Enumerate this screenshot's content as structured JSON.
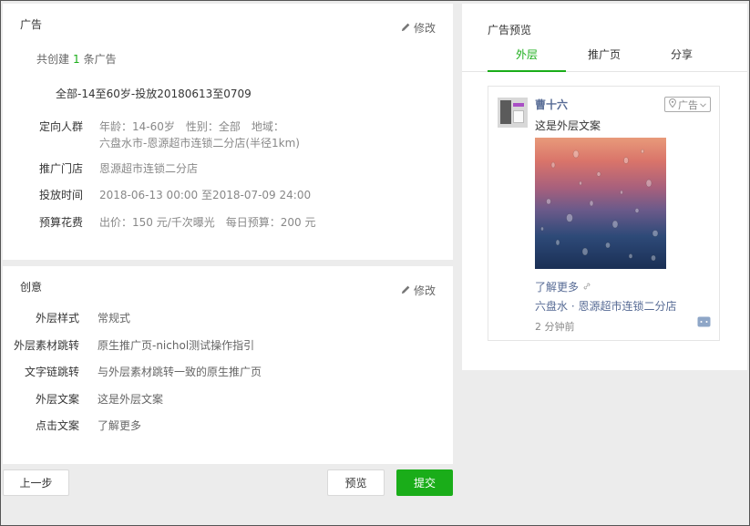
{
  "ad": {
    "title": "广告",
    "edit_label": "修改",
    "summary_prefix": "共创建",
    "summary_count": "1",
    "summary_suffix": "条广告",
    "headline": "全部-14至60岁-投放20180613至0709",
    "targeting": {
      "label": "定向人群",
      "age": "年龄：14-60岁",
      "gender": "性别：全部",
      "region": "地域：",
      "region_value": "六盘水市-恩源超市连锁二分店(半径1km)"
    },
    "store": {
      "label": "推广门店",
      "value": "恩源超市连锁二分店"
    },
    "schedule": {
      "label": "投放时间",
      "value": "2018-06-13 00:00 至2018-07-09 24:00"
    },
    "budget": {
      "label": "预算花费",
      "bid": "出价：150 元/千次曝光",
      "daily": "每日预算：200 元"
    }
  },
  "creative": {
    "title": "创意",
    "edit_label": "修改",
    "rows": [
      {
        "label": "外层样式",
        "value": "常规式"
      },
      {
        "label": "外层素材跳转",
        "value": "原生推广页-nichol测试操作指引"
      },
      {
        "label": "文字链跳转",
        "value": "与外层素材跳转一致的原生推广页"
      },
      {
        "label": "外层文案",
        "value": "这是外层文案"
      },
      {
        "label": "点击文案",
        "value": "了解更多"
      }
    ]
  },
  "footer": {
    "prev_label": "上一步",
    "preview_label": "预览",
    "submit_label": "提交"
  },
  "preview": {
    "title": "广告预览",
    "tabs": [
      {
        "label": "外层",
        "active": true
      },
      {
        "label": "推广页",
        "active": false
      },
      {
        "label": "分享",
        "active": false
      }
    ],
    "card": {
      "brand": "曹十六",
      "badge": "广告",
      "outer_text": "这是外层文案",
      "more_link": "了解更多",
      "location": "六盘水 · 恩源超市连锁二分店",
      "time": "2 分钟前"
    }
  },
  "colors": {
    "accent": "#1aad19",
    "link": "#576b95"
  }
}
